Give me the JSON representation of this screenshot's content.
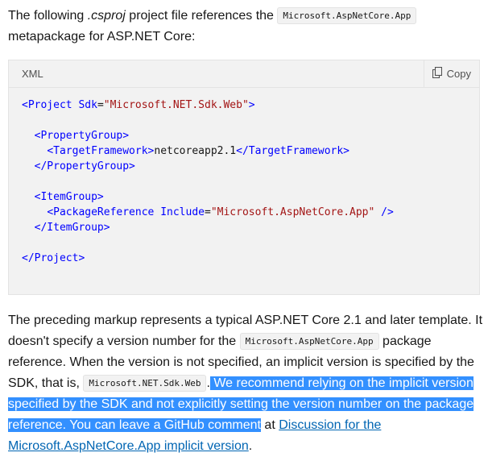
{
  "intro": {
    "text_before": "The following ",
    "emphasis": ".csproj",
    "text_middle": " project file references the ",
    "code": "Microsoft.AspNetCore.App",
    "text_after": " metapackage for ASP.NET Core:"
  },
  "code_block": {
    "language": "XML",
    "copy_label": "Copy",
    "lines": [
      "<Project Sdk=\"Microsoft.NET.Sdk.Web\">",
      "",
      "  <PropertyGroup>",
      "    <TargetFramework>netcoreapp2.1</TargetFramework>",
      "  </PropertyGroup>",
      "",
      "  <ItemGroup>",
      "    <PackageReference Include=\"Microsoft.AspNetCore.App\" />",
      "  </ItemGroup>",
      "",
      "</Project>"
    ]
  },
  "body": {
    "text1": "The preceding markup represents a typical ASP.NET Core 2.1 and later template. It doesn't specify a version number for the ",
    "code1": "Microsoft.AspNetCore.App",
    "text2": " package reference. When the version is not specified, an implicit version is specified by the SDK, that is, ",
    "code2": "Microsoft.NET.Sdk.Web",
    "text3": ".",
    "selected_text": " We recommend relying on the implicit version specified by the SDK and not explicitly setting the version number on the package reference. You can leave a GitHub comment",
    "text4": " at ",
    "link_text": "Discussion for the Microsoft.AspNetCore.App implicit version",
    "text5": "."
  },
  "colors": {
    "selection": "#3390ff",
    "link": "#0065b3",
    "xml_tag": "#0000ff",
    "xml_value": "#a31515",
    "code_background": "#f2f2f2"
  }
}
